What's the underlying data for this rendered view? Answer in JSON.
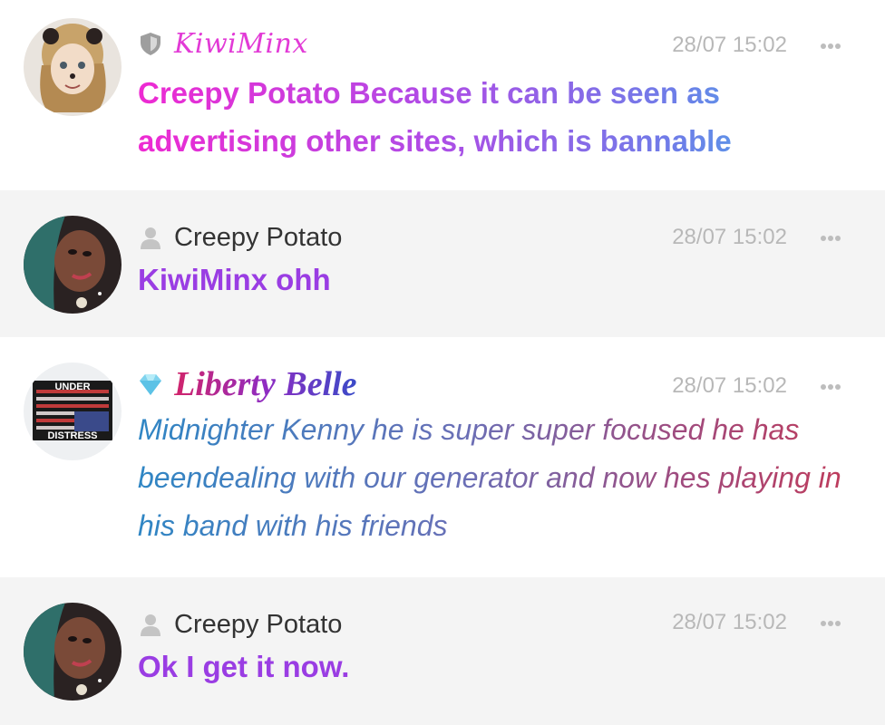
{
  "messages": [
    {
      "author": "KiwiMinx",
      "role_icon": "shield-icon",
      "timestamp": "28/07 15:02",
      "text": "Creepy Potato Because it can be seen as advertising other sites, which is bannable",
      "text_colors": [
        "#ee2ad2",
        "#3fc0e6"
      ],
      "name_color": "#e23ad6"
    },
    {
      "author": "Creepy Potato",
      "role_icon": "user-icon",
      "timestamp": "28/07 15:02",
      "text": "KiwiMinx ohh",
      "text_colors": [
        "#9a3de3"
      ]
    },
    {
      "author": "Liberty Belle",
      "role_icon": "diamond-icon",
      "timestamp": "28/07 15:02",
      "text": "Midnighter Kenny he is super super focused he has beendealing with our generator and now hes playing in his band with his friends",
      "avatar_text_top": "UNDER",
      "avatar_text_bottom": "DISTRESS",
      "text_colors": [
        "#2f86c4",
        "#c23a58"
      ]
    },
    {
      "author": "Creepy Potato",
      "role_icon": "user-icon",
      "timestamp": "28/07 15:02",
      "text": "Ok I get it now.",
      "text_colors": [
        "#9a3de3"
      ]
    }
  ],
  "more_icon": "more-dots-icon",
  "colors": {
    "alt_row_bg": "#f4f4f4",
    "timestamp": "#b8b8b8",
    "name_default": "#333333"
  }
}
